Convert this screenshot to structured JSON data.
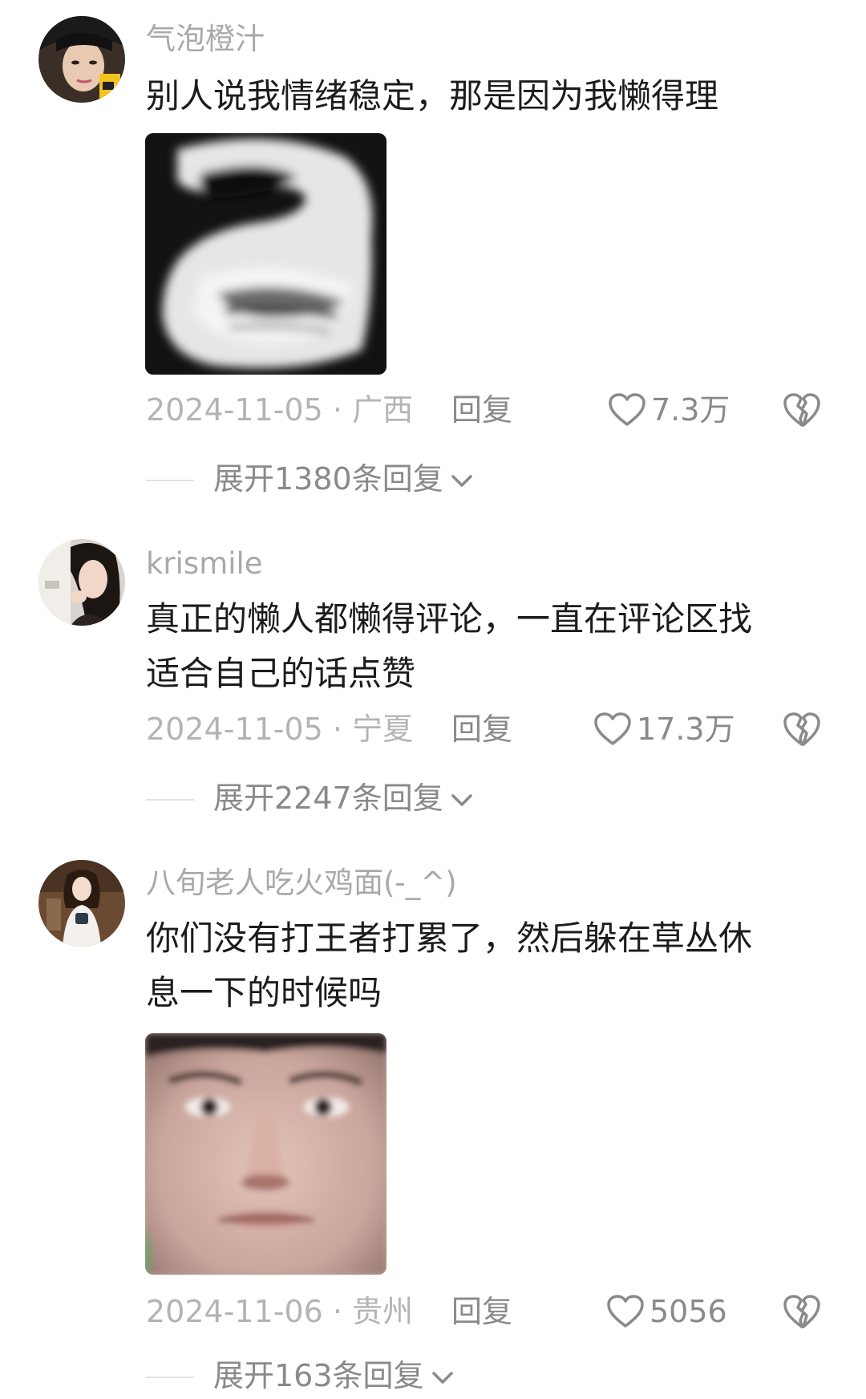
{
  "comments": [
    {
      "username": "气泡橙汁",
      "text": "别人说我情绪稳定，那是因为我懒得理",
      "has_sticker": true,
      "sticker": "grayscale-mouth-meme-sticker",
      "date_location": "2024-11-05 · 广西",
      "reply_label": "回复",
      "likes": "7.3万",
      "expand_label": "展开1380条回复"
    },
    {
      "username": "krismile",
      "text": "真正的懒人都懒得评论，一直在评论区找\n适合自己的话点赞",
      "has_sticker": false,
      "date_location": "2024-11-05 · 宁夏",
      "reply_label": "回复",
      "likes": "17.3万",
      "expand_label": "展开2247条回复"
    },
    {
      "username": "八旬老人吃火鸡面(-_^)",
      "text": "你们没有打王者打累了，然后躲在草丛休\n息一下的时候吗",
      "has_sticker": true,
      "sticker": "face-closeup-meme-sticker",
      "date_location": "2024-11-06 · 贵州",
      "reply_label": "回复",
      "likes": "5056",
      "expand_label": "展开163条回复"
    }
  ],
  "icons": {
    "like": "heart-outline-icon",
    "dislike": "broken-heart-icon",
    "expand": "chevron-down-icon"
  },
  "colors": {
    "username": "#a9a9a9",
    "text": "#1c1c1c",
    "meta": "#b4b4b4",
    "action": "#8a8a8a"
  }
}
